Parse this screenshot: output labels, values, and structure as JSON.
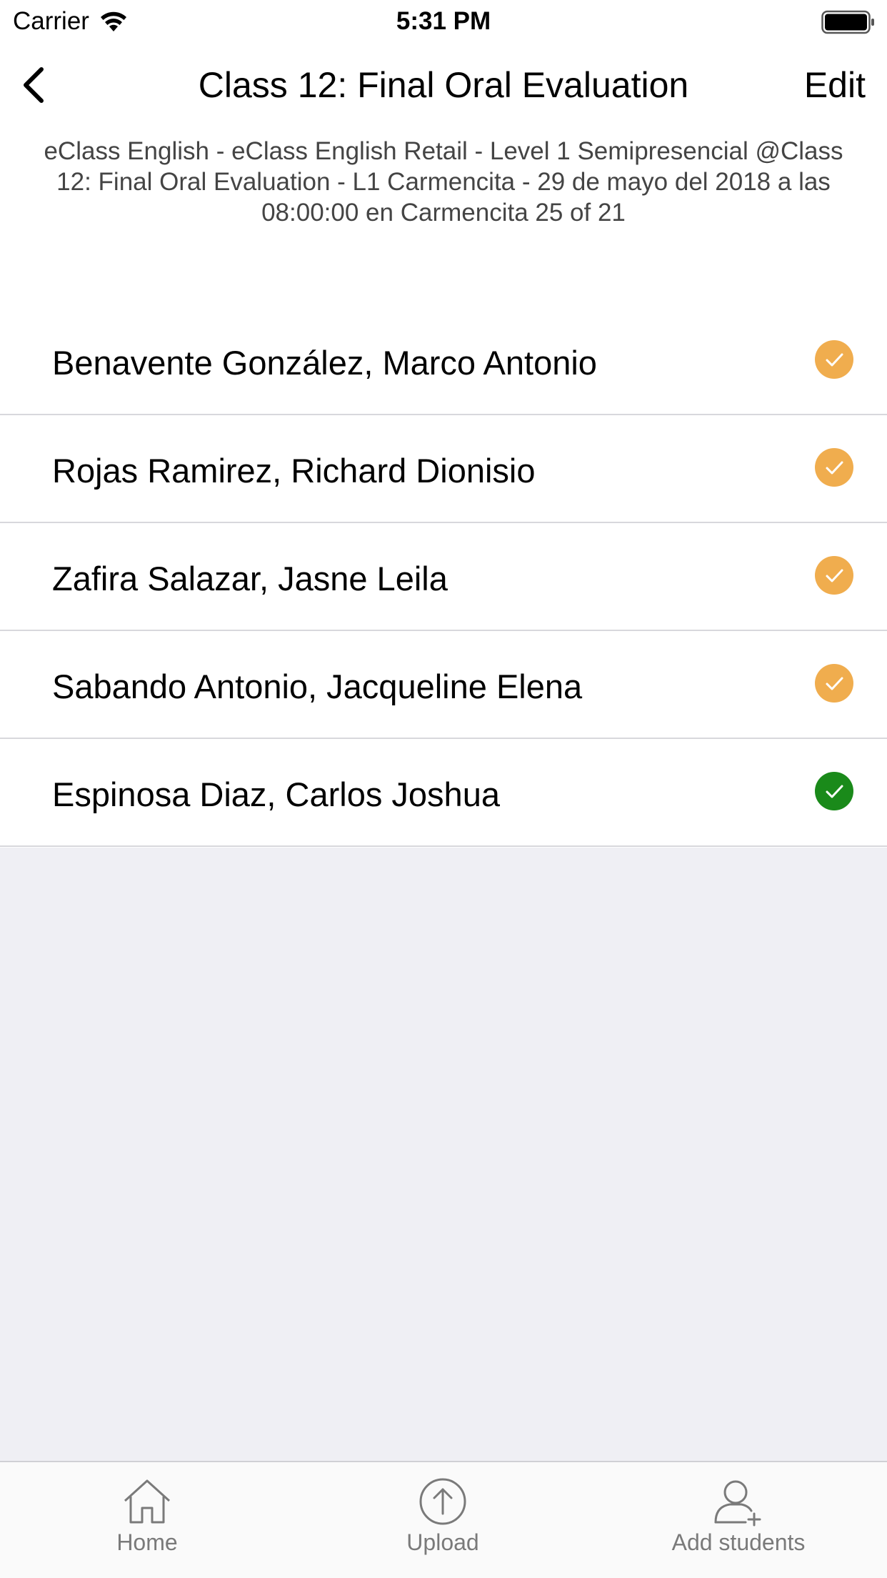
{
  "status_bar": {
    "carrier": "Carrier",
    "time": "5:31 PM",
    "wifi_icon": "wifi-icon",
    "battery_icon": "battery-icon"
  },
  "nav": {
    "back_icon": "chevron-left-icon",
    "title": "Class 12: Final Oral Evaluation",
    "edit_label": "Edit"
  },
  "subtitle": "eClass English - eClass English Retail -  Level 1 Semipresencial @Class 12: Final Oral Evaluation - L1 Carmencita - 29 de mayo del 2018 a las 08:00:00 en Carmencita 25 of 21",
  "students": [
    {
      "name": "Benavente González, Marco Antonio",
      "status_color": "#f0ad4e",
      "icon": "check-circle-icon"
    },
    {
      "name": "Rojas Ramirez, Richard Dionisio",
      "status_color": "#f0ad4e",
      "icon": "check-circle-icon"
    },
    {
      "name": "Zafira Salazar, Jasne Leila",
      "status_color": "#f0ad4e",
      "icon": "check-circle-icon"
    },
    {
      "name": "Sabando Antonio, Jacqueline Elena",
      "status_color": "#f0ad4e",
      "icon": "check-circle-icon"
    },
    {
      "name": "Espinosa Diaz, Carlos Joshua",
      "status_color": "#1a8a1a",
      "icon": "check-circle-icon"
    }
  ],
  "tabs": [
    {
      "label": "Home",
      "icon": "home-icon"
    },
    {
      "label": "Upload",
      "icon": "upload-icon"
    },
    {
      "label": "Add students",
      "icon": "add-user-icon"
    }
  ]
}
